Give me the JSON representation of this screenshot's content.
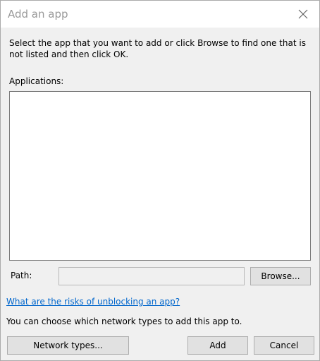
{
  "window": {
    "title": "Add an app"
  },
  "instruction": "Select the app that you want to add or click Browse to find one that is not listed and then click OK.",
  "applications": {
    "label": "Applications:",
    "items": []
  },
  "path": {
    "label": "Path:",
    "value": "",
    "browse_label": "Browse..."
  },
  "risks_link": "What are the risks of unblocking an app?",
  "network_note": "You can choose which network types to add this app to.",
  "buttons": {
    "network_types": "Network types...",
    "add": "Add",
    "cancel": "Cancel"
  },
  "icons": {
    "close": "close-icon"
  },
  "colors": {
    "link": "#0066cc",
    "dialog_bg": "#f0f0f0",
    "button_bg": "#e1e1e1"
  }
}
